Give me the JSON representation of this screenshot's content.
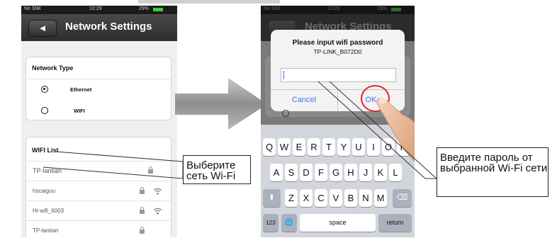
{
  "left_phone": {
    "status": {
      "carrier": "No SIM",
      "time": "10:29",
      "battery": "29%"
    },
    "nav": {
      "back_glyph": "◄",
      "title": "Network Settings"
    },
    "network_type": {
      "heading": "Network Type",
      "options": [
        {
          "label": "Ethernet",
          "selected": true
        },
        {
          "label": "WIFI",
          "selected": false
        }
      ]
    },
    "wifi_list": {
      "heading": "WIFI List",
      "networks": [
        "TP-lantian",
        "hscaigou",
        "Hi-wifi_6003",
        "TP-lantian"
      ]
    }
  },
  "right_phone": {
    "status": {
      "carrier": "No SIM",
      "time": "10:29",
      "battery": "29%"
    },
    "nav": {
      "title": "Network Settings"
    },
    "dialog": {
      "title": "Please input wifi password",
      "subtitle": "TP-LINK_B072D0",
      "password_value": "",
      "cancel_label": "Cancel",
      "ok_label": "OK"
    },
    "keyboard": {
      "row1": [
        "Q",
        "W",
        "E",
        "R",
        "T",
        "Y",
        "U",
        "I",
        "O",
        "P"
      ],
      "row2": [
        "A",
        "S",
        "D",
        "F",
        "G",
        "H",
        "J",
        "K",
        "L"
      ],
      "row3": [
        "Z",
        "X",
        "C",
        "V",
        "B",
        "N",
        "M"
      ],
      "shift_glyph": "⬆",
      "delete_glyph": "⌫",
      "numbers_label": "123",
      "globe_glyph": "🌐",
      "space_label": "space",
      "return_label": "return"
    }
  },
  "callouts": {
    "select_network": "Выберите сеть Wi-Fi",
    "enter_password": "Введите пароль от выбранной Wi-Fi сети"
  },
  "colors": {
    "accent_blue": "#2f7bf5",
    "highlight_red": "#e0262b",
    "arrow_gray": "#9a9a9a"
  }
}
